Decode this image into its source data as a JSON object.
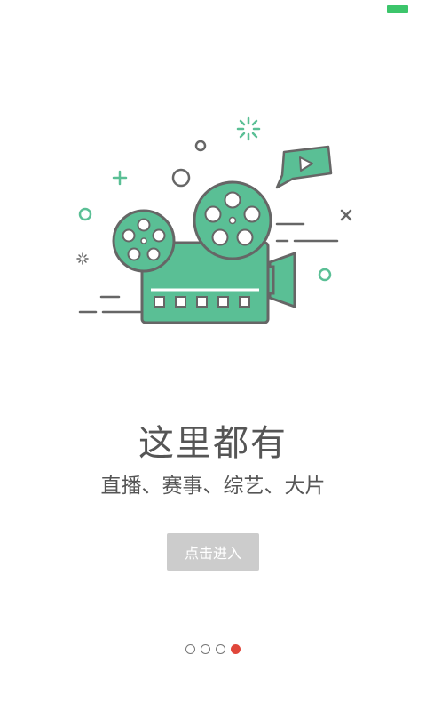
{
  "colors": {
    "accent": "#5abf95",
    "outline": "#666666",
    "button_bg": "#cccccc",
    "active_dot": "#e0463a",
    "battery": "#3cc56b"
  },
  "illustration": {
    "icon": "film-camera-icon"
  },
  "headline": "这里都有",
  "subtitle": "直播、赛事、综艺、大片",
  "enter_button": {
    "label": "点击进入"
  },
  "pager": {
    "total": 4,
    "active_index": 3
  }
}
